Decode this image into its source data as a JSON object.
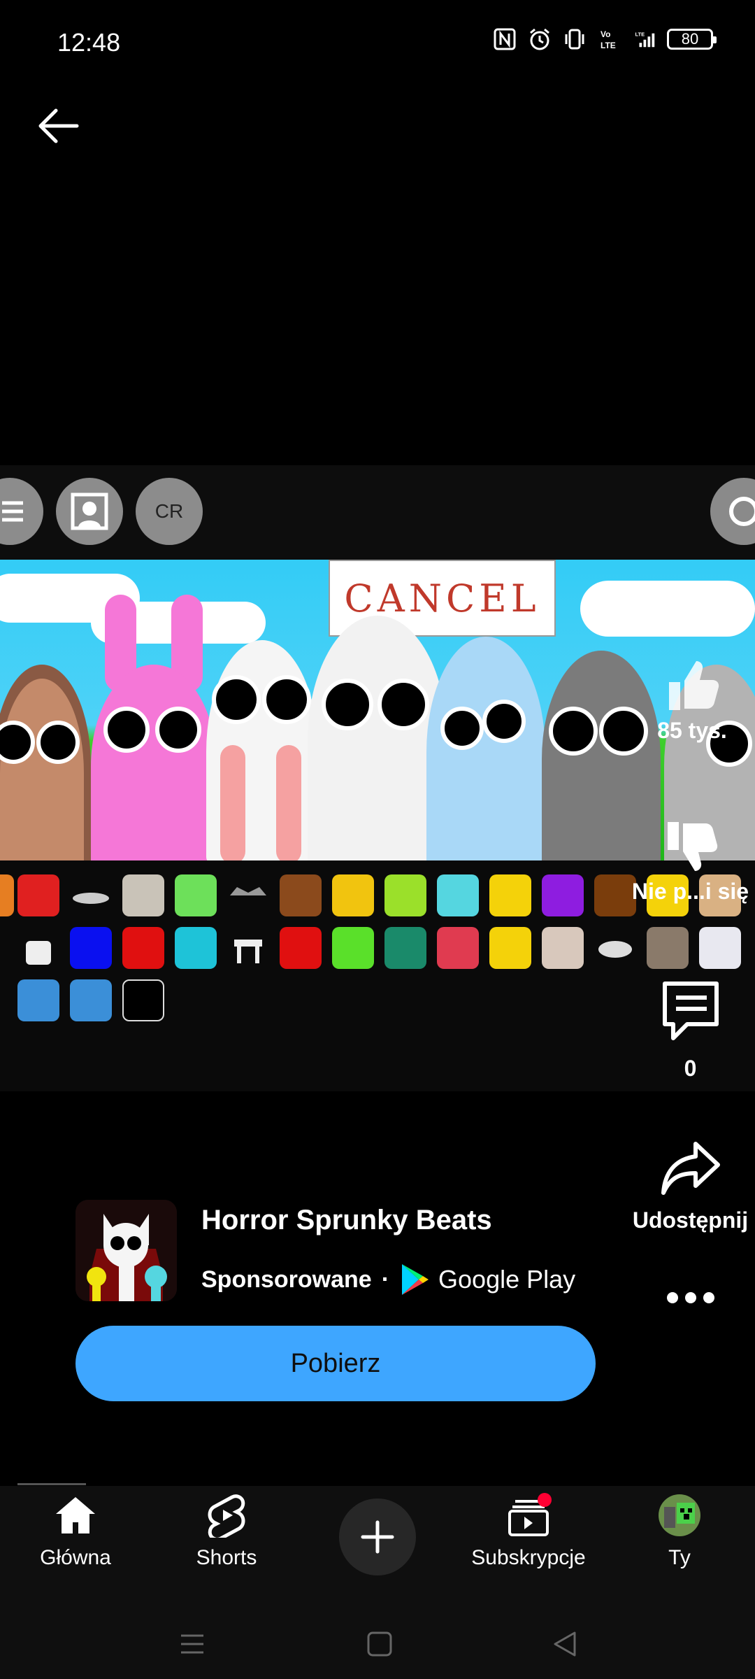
{
  "status_bar": {
    "time": "12:48",
    "battery": "80",
    "icons": [
      "nfc-icon",
      "alarm-icon",
      "vibrate-icon",
      "volte-icon",
      "lte-signal-icon",
      "battery-icon"
    ]
  },
  "video": {
    "overlay_buttons": {
      "cr_label": "CR"
    },
    "sign_text": "CANCEL"
  },
  "actions": {
    "likes": "85 tys.",
    "dislike_label": "Nie p...i się",
    "comments": "0",
    "share_label": "Udostępnij"
  },
  "ad": {
    "title": "Horror Sprunky Beats",
    "sponsored": "Sponsorowane",
    "separator": "·",
    "store": "Google Play",
    "cta": "Pobierz",
    "cta_color": "#3ea6ff"
  },
  "nav": {
    "items": [
      {
        "label": "Główna",
        "icon": "home-icon"
      },
      {
        "label": "Shorts",
        "icon": "shorts-icon"
      },
      {
        "label": "",
        "icon": "plus-icon"
      },
      {
        "label": "Subskrypcje",
        "icon": "subscriptions-icon"
      },
      {
        "label": "Ty",
        "icon": "avatar"
      }
    ]
  }
}
